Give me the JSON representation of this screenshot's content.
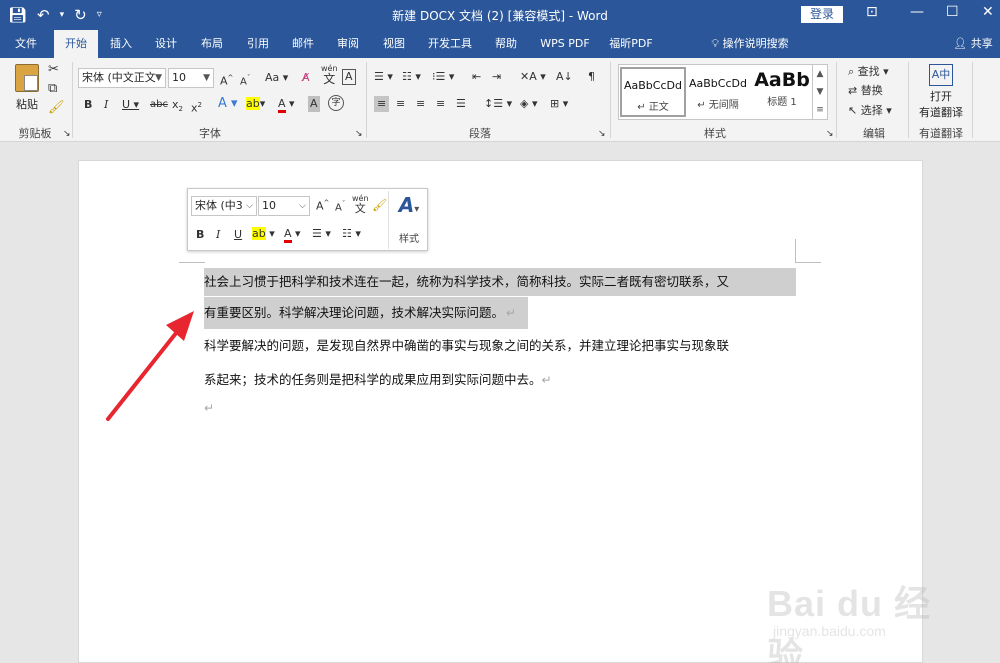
{
  "window": {
    "title": "新建 DOCX 文档 (2) [兼容模式]  -  Word",
    "login_label": "登录",
    "share_label": "共享",
    "tellme_label": "操作说明搜索"
  },
  "tabs": [
    {
      "label": "文件"
    },
    {
      "label": "开始"
    },
    {
      "label": "插入"
    },
    {
      "label": "设计"
    },
    {
      "label": "布局"
    },
    {
      "label": "引用"
    },
    {
      "label": "邮件"
    },
    {
      "label": "审阅"
    },
    {
      "label": "视图"
    },
    {
      "label": "开发工具"
    },
    {
      "label": "帮助"
    },
    {
      "label": "WPS PDF"
    },
    {
      "label": "福昕PDF"
    }
  ],
  "ribbon": {
    "clipboard": {
      "paste_label": "粘贴",
      "group_label": "剪贴板"
    },
    "font": {
      "font_name": "宋体 (中文正文",
      "font_size": "10",
      "aa_label": "Aa",
      "group_label": "字体",
      "pinyin_label": "wén"
    },
    "paragraph": {
      "group_label": "段落"
    },
    "styles": {
      "group_label": "样式",
      "items": [
        {
          "sample": "AaBbCcDd",
          "name": "正文"
        },
        {
          "sample": "AaBbCcDd",
          "name": "无间隔"
        },
        {
          "sample": "AaBb",
          "name": "标题 1"
        }
      ]
    },
    "editing": {
      "find_label": "查找",
      "replace_label": "替换",
      "select_label": "选择",
      "group_label": "编辑"
    },
    "youdao": {
      "open_label": "打开",
      "open_sub": "有道翻译",
      "group_label": "有道翻译"
    }
  },
  "minitoolbar": {
    "font_name": "宋体 (中3",
    "font_size": "10",
    "styles_label": "样式",
    "pinyin_label": "wén"
  },
  "document": {
    "para1_line1": "社会上习惯于把科学和技术连在一起，统称为科学技术，简称科技。实际二者既有密切联系，又",
    "para1_line2": "有重要区别。科学解决理论问题，技术解决实际问题。",
    "para2_line1": "科学要解决的问题，是发现自然界中确凿的事实与现象之间的关系，并建立理论把事实与现象联",
    "para2_line2": "系起来；技术的任务则是把科学的成果应用到实际问题中去。",
    "pilcrow": "↵"
  },
  "watermark": {
    "brand": "Bai du 经验",
    "url": "jingyan.baidu.com"
  },
  "colors": {
    "accent": "#2b579a",
    "arrow": "#e8262f",
    "highlight": "#cfcfcf"
  }
}
